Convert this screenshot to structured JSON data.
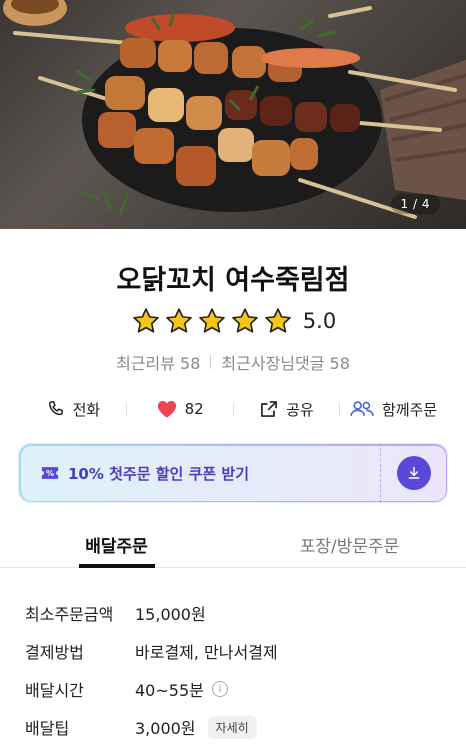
{
  "hero": {
    "counter": "1 / 4"
  },
  "store": {
    "name": "오닭꼬치 여수죽림점",
    "rating": "5.0",
    "stars": 5
  },
  "reviews": {
    "recent_reviews": "최근리뷰 58",
    "owner_replies": "최근사장님댓글 58"
  },
  "actions": {
    "call": "전화",
    "likes": "82",
    "share": "공유",
    "group_order": "함께주문"
  },
  "coupon": {
    "text": "10% 첫주문 할인 쿠폰 받기"
  },
  "tabs": {
    "delivery": "배달주문",
    "pickup": "포장/방문주문"
  },
  "info": {
    "min_order_label": "최소주문금액",
    "min_order_value": "15,000원",
    "payment_label": "결제방법",
    "payment_value": "바로결제, 만나서결제",
    "time_label": "배달시간",
    "time_value": "40~55분",
    "tip_label": "배달팁",
    "tip_value": "3,000원",
    "tip_detail": "자세히"
  },
  "colors": {
    "accent": "#5a48d8",
    "heart": "#f04452",
    "star": "#f5c518"
  }
}
